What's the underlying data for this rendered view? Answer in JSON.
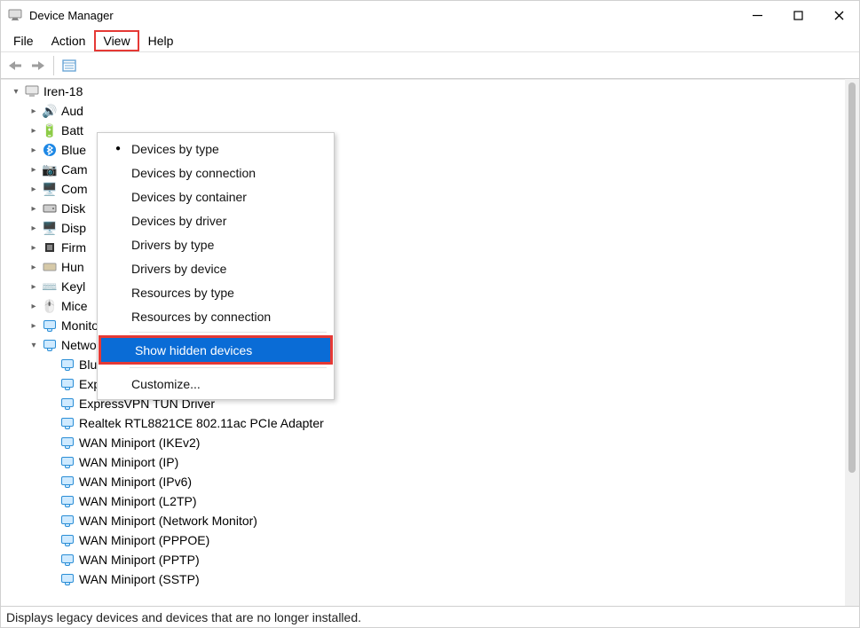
{
  "window": {
    "title": "Device Manager"
  },
  "menubar": {
    "file": "File",
    "action": "Action",
    "view": "View",
    "help": "Help"
  },
  "viewmenu": {
    "items": [
      "Devices by type",
      "Devices by connection",
      "Devices by container",
      "Devices by driver",
      "Drivers by type",
      "Drivers by device",
      "Resources by type",
      "Resources by connection"
    ],
    "show_hidden": "Show hidden devices",
    "customize": "Customize..."
  },
  "tree": {
    "root": "Iren-18",
    "cats": [
      "Aud",
      "Batt",
      "Blue",
      "Cam",
      "Com",
      "Disk",
      "Disp",
      "Firm",
      "Hun",
      "Keyl",
      "Mice"
    ],
    "monitors": "Monitors",
    "network": "Network adapters",
    "net_items": [
      "Bluetooth Device (Personal Area Network)",
      "ExpressVPN TAP Adapter",
      "ExpressVPN TUN Driver",
      "Realtek RTL8821CE 802.11ac PCIe Adapter",
      "WAN Miniport (IKEv2)",
      "WAN Miniport (IP)",
      "WAN Miniport (IPv6)",
      "WAN Miniport (L2TP)",
      "WAN Miniport (Network Monitor)",
      "WAN Miniport (PPPOE)",
      "WAN Miniport (PPTP)",
      "WAN Miniport (SSTP)"
    ]
  },
  "statusbar": "Displays legacy devices and devices that are no longer installed."
}
